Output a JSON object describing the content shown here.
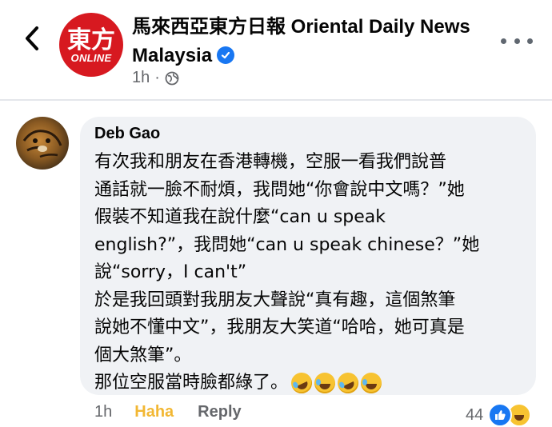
{
  "post": {
    "page_name": "馬來西亞東方日報 Oriental Daily News Malaysia",
    "logo_text_big": "東方",
    "logo_text_small": "ONLINE",
    "time": "1h",
    "separator": "·",
    "icons": {
      "back": "chevron-left-icon",
      "verified": "verified-badge-icon",
      "audience": "globe-icon",
      "more": "more-icon"
    }
  },
  "comment": {
    "author": "Deb Gao",
    "text": "有次我和朋友在香港轉機，空服一看我們說普\n通話就一臉不耐煩，我問她“你會說中文嗎？”她\n假裝不知道我在說什麼“can u speak\nenglish?”，我問她“can u speak chinese？”她\n說“sorry，I can't”\n於是我回頭對我朋友大聲說“真有趣，這個煞筆\n說她不懂中文”，我朋友大笑道“哈哈，她可真是\n個大煞筆”。\n那位空服當時臉都綠了。",
    "emojis": [
      "rolling-on-floor-laughing-icon",
      "tears-of-joy-icon",
      "rolling-on-floor-laughing-icon",
      "tears-of-joy-icon"
    ],
    "time": "1h",
    "reaction_label": "Haha",
    "reply_label": "Reply",
    "reaction_count": "44",
    "reaction_icons": [
      "like-reaction-icon",
      "haha-reaction-icon"
    ]
  },
  "colors": {
    "accent": "#1877f2",
    "haha": "#f2b733",
    "bubble": "#f0f2f5",
    "secondary_text": "#65676b",
    "logo_red": "#d71920"
  }
}
